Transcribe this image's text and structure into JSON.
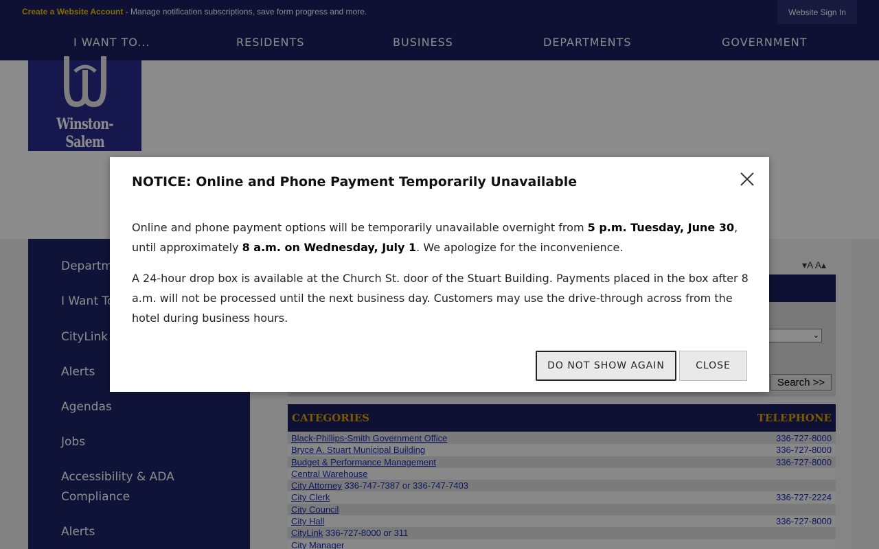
{
  "topbar": {
    "create_link": "Create a Website Account",
    "create_text": " - Manage notification subscriptions, save form progress and more.",
    "signin": "Website Sign In"
  },
  "nav": [
    "I WANT TO...",
    "RESIDENTS",
    "BUSINESS",
    "DEPARTMENTS",
    "GOVERNMENT"
  ],
  "logo": {
    "wordmark": "Winston-Salem"
  },
  "sidebar": {
    "items": [
      "Departments",
      "I Want To",
      "CityLink",
      "Alerts",
      "Agendas",
      "Jobs",
      "Accessibility & ADA Compliance",
      "Alerts"
    ]
  },
  "content": {
    "font_decrease": "▾A",
    "font_increase": "A▴",
    "search_button": "Search >>",
    "categories_header": "CATEGORIES",
    "telephone_header": "TELEPHONE",
    "rows": [
      {
        "name": "Black-Phillips-Smith Government Office",
        "extra": "",
        "phone": "336-727-8000"
      },
      {
        "name": "Bryce A. Stuart Municipal Building",
        "extra": "",
        "phone": "336-727-8000"
      },
      {
        "name": "Budget & Performance Management",
        "extra": "",
        "phone": "336-727-8000"
      },
      {
        "name": "Central Warehouse",
        "extra": "",
        "phone": ""
      },
      {
        "name": "City Attorney",
        "extra": " 336-747-7387 or 336-747-7403",
        "phone": ""
      },
      {
        "name": "City Clerk",
        "extra": "",
        "phone": "336-727-2224"
      },
      {
        "name": "City Council",
        "extra": "",
        "phone": ""
      },
      {
        "name": "City Hall",
        "extra": "",
        "phone": "336-727-8000"
      },
      {
        "name": "CityLink",
        "extra": " 336-727-8000 or 311",
        "phone": ""
      },
      {
        "name": "City Manager",
        "extra": "",
        "phone": ""
      }
    ]
  },
  "modal": {
    "title": "NOTICE: Online and Phone Payment Temporarily Unavailable",
    "p1_a": "Online and phone payment options will be temporarily unavailable overnight from ",
    "p1_b": "5 p.m. Tuesday, June 30",
    "p1_c": ", until approximately ",
    "p1_d": "8 a.m. on Wednesday, July 1",
    "p1_e": ". We apologize for the inconvenience.",
    "p2": "A 24-hour drop box is available at the Church St. door of the Stuart Building. Payments placed in the box after 8 a.m. will not be processed until the next business day. Customers may use the drive-through across from the hotel during business hours.",
    "btn_dont_show": "DO NOT SHOW AGAIN",
    "btn_close": "CLOSE"
  },
  "colors": {
    "navy": "#1a1f5e",
    "gold": "#f0c200",
    "link_blue": "#1a2ab0"
  }
}
